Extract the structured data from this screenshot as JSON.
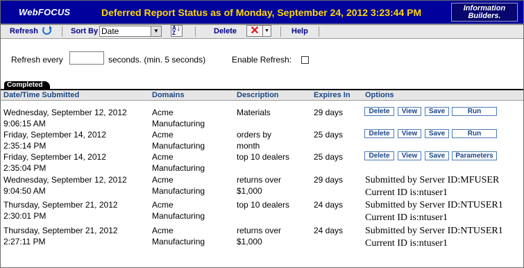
{
  "app": {
    "brand": "WebFOCUS",
    "title": "Deferred Report Status as of Monday, September 24, 2012 3:23:44 PM",
    "logo_line1": "Information",
    "logo_line2": "Builders."
  },
  "toolbar": {
    "refresh_label": "Refresh",
    "sort_label": "Sort By",
    "sort_value": "Date",
    "delete_label": "Delete",
    "help_label": "Help"
  },
  "refresh": {
    "label_prefix": "Refresh every",
    "label_suffix": "seconds. (min. 5 seconds)",
    "input_value": "",
    "enable_label": "Enable Refresh:"
  },
  "tab": {
    "label": "Completed"
  },
  "columns": [
    "Date/Time Submitted",
    "Domains",
    "Description",
    "Expires In",
    "Options"
  ],
  "rows": [
    {
      "date": "Wednesday, September 12, 2012",
      "time": "9:06:15 AM",
      "domain1": "Acme",
      "domain2": "Manufacturing",
      "desc1": "Materials",
      "desc2": "",
      "expires": "29 days",
      "options": [
        "Delete",
        "View",
        "Save",
        "Run"
      ]
    },
    {
      "date": "Friday, September 14, 2012",
      "time": "2:35:14 PM",
      "domain1": "Acme",
      "domain2": "Manufacturing",
      "desc1": "orders by",
      "desc2": "month",
      "expires": "25 days",
      "options": [
        "Delete",
        "View",
        "Save",
        "Run"
      ]
    },
    {
      "date": "Friday, September 14, 2012",
      "time": "2:35:04 PM",
      "domain1": "Acme",
      "domain2": "Manufacturing",
      "desc1": "top 10 dealers",
      "desc2": "",
      "expires": "25 days",
      "options": [
        "Delete",
        "View",
        "Save",
        "Parameters"
      ]
    },
    {
      "date": "Wednesday, September 12, 2012",
      "time": "9:04:50 AM",
      "domain1": "Acme",
      "domain2": "Manufacturing",
      "desc1": "returns over",
      "desc2": "$1,000",
      "expires": "29 days",
      "submitted1": "Submitted by Server ID:MFUSER",
      "submitted2": "Current ID is:ntuser1"
    },
    {
      "date": "Thursday, September 21, 2012",
      "time": "2:30:01 PM",
      "domain1": "Acme",
      "domain2": "Manufacturing",
      "desc1": "top 10 dealers",
      "desc2": "",
      "expires": "24 days",
      "submitted1": "Submitted by Server ID:NTUSER1",
      "submitted2": "Current ID is:ntuser1"
    },
    {
      "date": "Thursday, September 21, 2012",
      "time": "2:27:11 PM",
      "domain1": "Acme",
      "domain2": "Manufacturing",
      "desc1": "returns over",
      "desc2": "$1,000",
      "expires": "24 days",
      "submitted1": "Submitted by Server ID:NTUSER1",
      "submitted2": "Current ID is:ntuser1"
    }
  ]
}
